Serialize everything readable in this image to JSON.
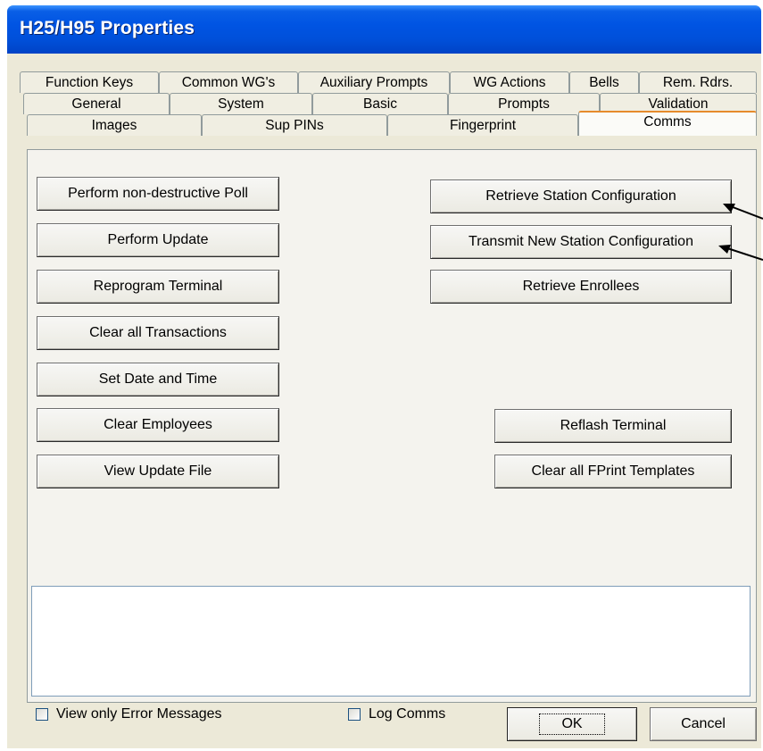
{
  "window": {
    "title": "H25/H95 Properties"
  },
  "tabs": {
    "row1": [
      "Function Keys",
      "Common WG's",
      "Auxiliary Prompts",
      "WG Actions",
      "Bells",
      "Rem. Rdrs."
    ],
    "row2": [
      "General",
      "System",
      "Basic",
      "Prompts",
      "Validation"
    ],
    "row3": [
      "Images",
      "Sup PINs",
      "Fingerprint",
      "Comms"
    ],
    "active": "Comms"
  },
  "left_buttons": [
    "Perform non-destructive Poll",
    "Perform Update",
    "Reprogram Terminal",
    "Clear all Transactions",
    "Set Date and Time",
    "Clear Employees",
    "View Update File"
  ],
  "right_buttons": [
    "Retrieve Station Configuration",
    "Transmit New Station Configuration",
    "Retrieve Enrollees",
    "Reflash Terminal",
    "Clear all FPrint Templates"
  ],
  "log": {
    "text": ""
  },
  "options": [
    {
      "label": "View only Error Messages",
      "checked": false
    },
    {
      "label": "Log Comms",
      "checked": false
    }
  ],
  "footer": {
    "ok_label": "OK",
    "cancel_label": "Cancel"
  }
}
